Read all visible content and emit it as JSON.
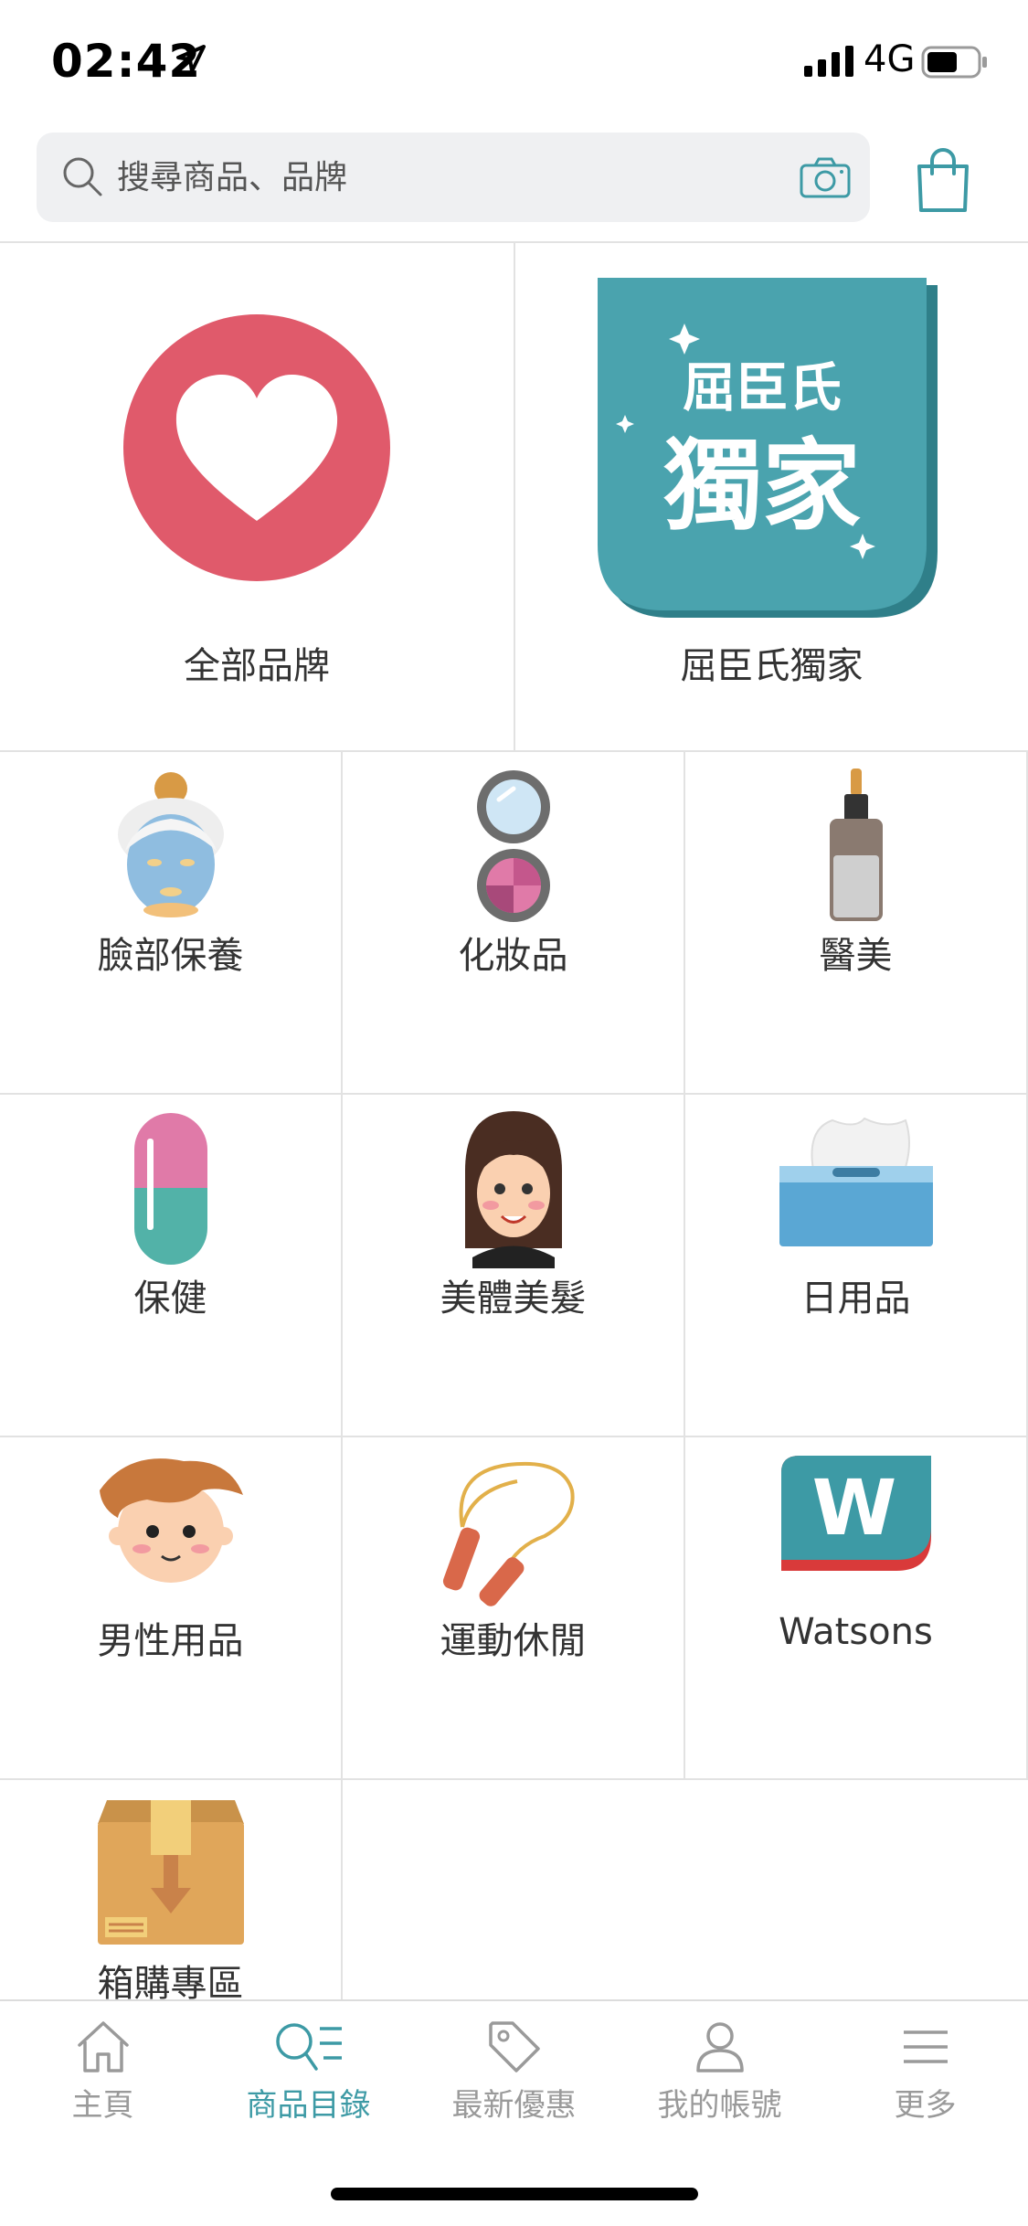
{
  "status_bar": {
    "time": "02:42",
    "network": "4G"
  },
  "search": {
    "placeholder": "搜尋商品、品牌"
  },
  "featured": [
    {
      "label": "全部品牌",
      "icon": "heart-icon"
    },
    {
      "label": "屈臣氏獨家",
      "icon": "watsons-exclusive-badge",
      "badge_line1": "屈臣氏",
      "badge_line2": "獨家"
    }
  ],
  "categories": [
    {
      "label": "臉部保養",
      "icon": "face-mask-icon"
    },
    {
      "label": "化妝品",
      "icon": "compact-mirror-icon"
    },
    {
      "label": "醫美",
      "icon": "serum-bottle-icon"
    },
    {
      "label": "保健",
      "icon": "capsule-icon"
    },
    {
      "label": "美體美髮",
      "icon": "woman-face-icon"
    },
    {
      "label": "日用品",
      "icon": "tissue-box-icon"
    },
    {
      "label": "男性用品",
      "icon": "man-face-icon"
    },
    {
      "label": "運動休閒",
      "icon": "jump-rope-icon"
    },
    {
      "label": "Watsons",
      "icon": "watsons-logo-icon",
      "logo_letter": "W"
    },
    {
      "label": "箱購專區",
      "icon": "cardboard-box-icon"
    }
  ],
  "tabs": [
    {
      "label": "主頁",
      "icon": "home-icon",
      "active": false
    },
    {
      "label": "商品目錄",
      "icon": "catalog-search-icon",
      "active": true
    },
    {
      "label": "最新優惠",
      "icon": "price-tag-icon",
      "active": false
    },
    {
      "label": "我的帳號",
      "icon": "user-icon",
      "active": false
    },
    {
      "label": "更多",
      "icon": "menu-icon",
      "active": false
    }
  ],
  "colors": {
    "accent": "#3d9aa5",
    "heart_red": "#e05a6b",
    "badge_teal": "#4aa3ae",
    "inactive": "#9a9a9a"
  }
}
